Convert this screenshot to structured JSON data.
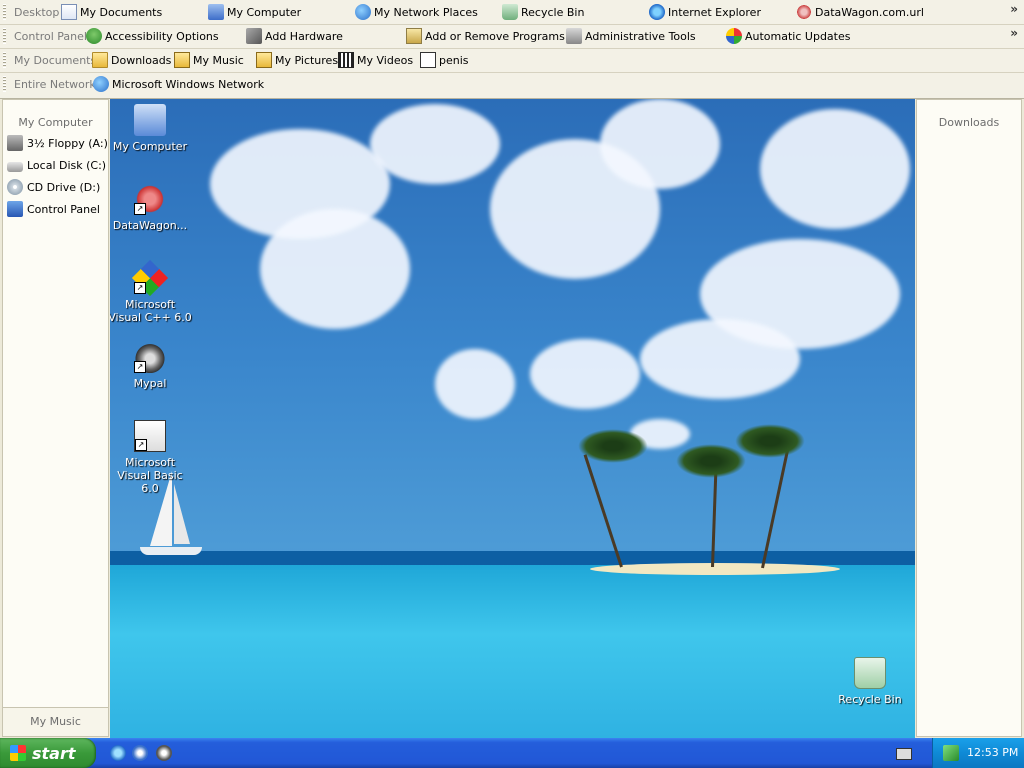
{
  "toolbars": {
    "row1": {
      "title": "Desktop",
      "items": [
        {
          "label": "My Documents",
          "icon": "my-documents-icon"
        },
        {
          "label": "My Computer",
          "icon": "my-computer-icon"
        },
        {
          "label": "My Network Places",
          "icon": "network-places-icon"
        },
        {
          "label": "Recycle Bin",
          "icon": "recycle-bin-icon"
        },
        {
          "label": "Internet Explorer",
          "icon": "internet-explorer-icon"
        },
        {
          "label": "DataWagon.com.url",
          "icon": "url-shortcut-icon"
        }
      ],
      "overflow": "»"
    },
    "row2": {
      "title": "Control Panel",
      "items": [
        {
          "label": "Accessibility Options",
          "icon": "accessibility-icon"
        },
        {
          "label": "Add Hardware",
          "icon": "add-hardware-icon"
        },
        {
          "label": "Add or Remove Programs",
          "icon": "add-remove-programs-icon"
        },
        {
          "label": "Administrative Tools",
          "icon": "administrative-tools-icon"
        },
        {
          "label": "Automatic Updates",
          "icon": "automatic-updates-icon"
        }
      ],
      "overflow": "»"
    },
    "row3": {
      "title": "My Documents",
      "items": [
        {
          "label": "Downloads",
          "icon": "folder-icon"
        },
        {
          "label": "My Music",
          "icon": "music-folder-icon"
        },
        {
          "label": "My Pictures",
          "icon": "pictures-folder-icon"
        },
        {
          "label": "My Videos",
          "icon": "videos-folder-icon"
        },
        {
          "label": "penis",
          "icon": "shortcut-file-icon"
        }
      ]
    },
    "row4": {
      "title": "Entire Network",
      "items": [
        {
          "label": "Microsoft Windows Network",
          "icon": "windows-network-icon"
        }
      ]
    }
  },
  "left_panel": {
    "title": "My Computer",
    "items": [
      {
        "label": "3½ Floppy (A:)",
        "icon": "floppy-drive-icon"
      },
      {
        "label": "Local Disk (C:)",
        "icon": "local-disk-icon"
      },
      {
        "label": "CD Drive (D:)",
        "icon": "cd-drive-icon"
      },
      {
        "label": "Control Panel",
        "icon": "control-panel-icon"
      }
    ],
    "footer": "My Music"
  },
  "right_panel": {
    "title": "Downloads"
  },
  "desktop_icons": [
    {
      "label": "My Computer",
      "icon": "my-computer-icon"
    },
    {
      "label": "DataWagon...",
      "icon": "url-shortcut-icon"
    },
    {
      "label": "Microsoft Visual C++ 6.0",
      "icon": "visual-cpp-icon"
    },
    {
      "label": "Mypal",
      "icon": "mypal-icon"
    },
    {
      "label": "Microsoft Visual Basic 6.0",
      "icon": "visual-basic-icon"
    },
    {
      "label": "Recycle Bin",
      "icon": "recycle-bin-icon"
    }
  ],
  "taskbar": {
    "start_label": "start",
    "clock": "12:53 PM"
  }
}
